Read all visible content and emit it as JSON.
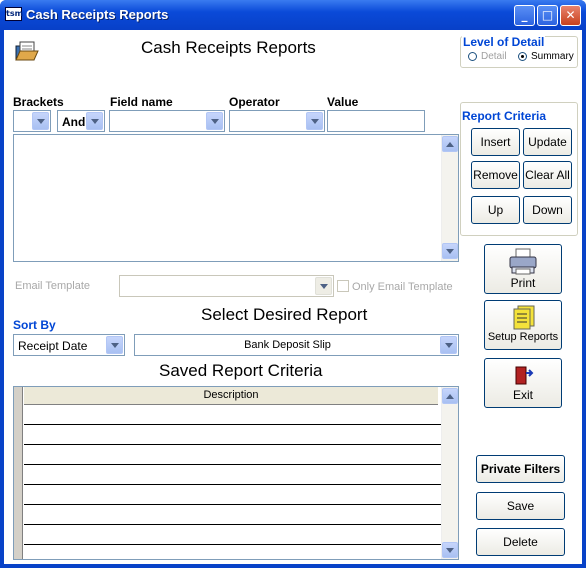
{
  "window": {
    "title": "Cash Receipts Reports",
    "app_icon_text": "tsm"
  },
  "header": {
    "title": "Cash Receipts Reports"
  },
  "level_of_detail": {
    "title": "Level of Detail",
    "options": [
      "Detail",
      "Summary"
    ],
    "selected": "Summary"
  },
  "criteria_headers": {
    "brackets": "Brackets",
    "field_name": "Field name",
    "operator": "Operator",
    "value": "Value"
  },
  "criteria_row": {
    "bracket": "",
    "conjunction": "And",
    "field": "",
    "operator": "",
    "value": ""
  },
  "report_criteria": {
    "title": "Report Criteria",
    "buttons": [
      "Insert",
      "Update",
      "Remove",
      "Clear All",
      "Up",
      "Down"
    ]
  },
  "email": {
    "label": "Email Template",
    "value": "",
    "only_label": "Only Email Template"
  },
  "sort": {
    "label": "Sort By",
    "value": "Receipt Date"
  },
  "select_report": {
    "title": "Select Desired Report",
    "value": "Bank Deposit Slip"
  },
  "saved": {
    "title": "Saved Report Criteria",
    "column": "Description",
    "rows": [
      "",
      "",
      "",
      "",
      "",
      "",
      "",
      ""
    ]
  },
  "side_buttons": {
    "print": "Print",
    "setup": "Setup Reports",
    "exit": "Exit",
    "private": "Private Filters",
    "save": "Save",
    "delete": "Delete"
  }
}
